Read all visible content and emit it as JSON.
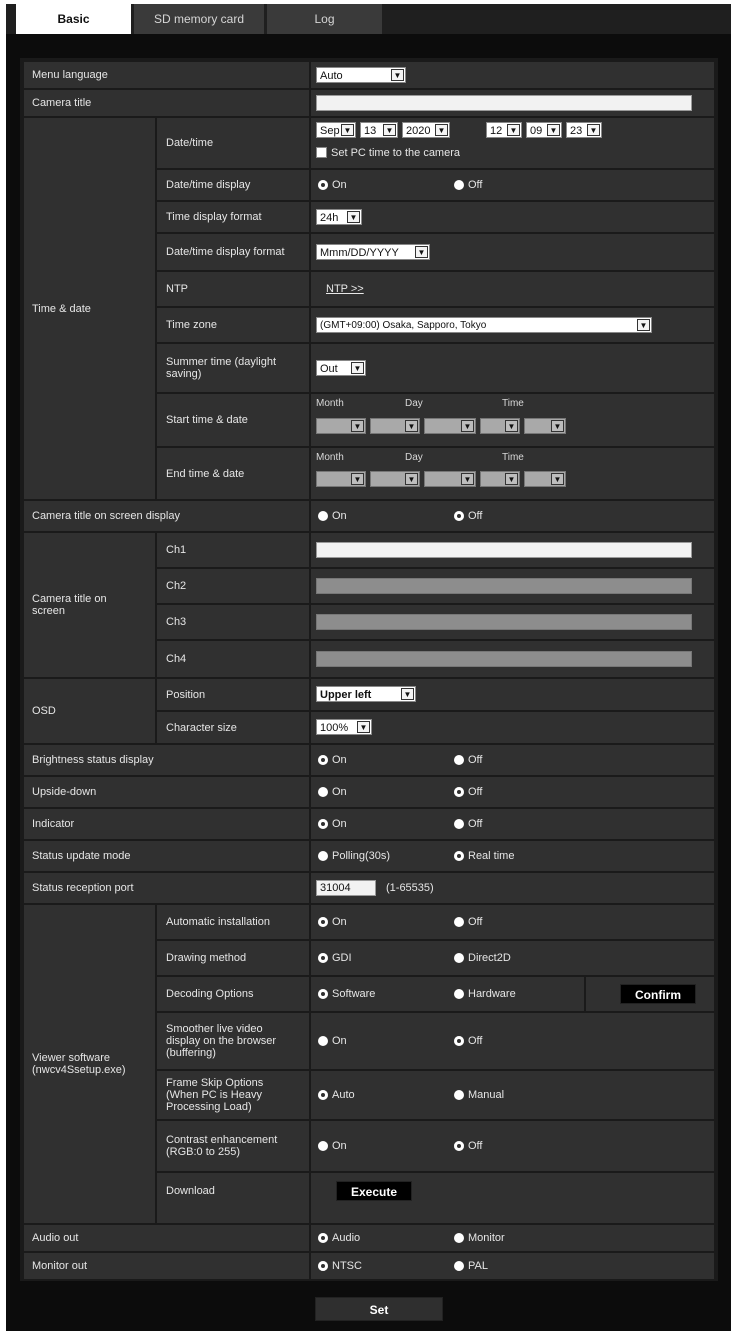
{
  "tabs": [
    {
      "label": "Basic",
      "active": true
    },
    {
      "label": "SD memory card",
      "active": false
    },
    {
      "label": "Log",
      "active": false
    }
  ],
  "menu_language": {
    "label": "Menu language",
    "value": "Auto"
  },
  "camera_title": {
    "label": "Camera title",
    "value": ""
  },
  "time_date": {
    "label": "Time & date",
    "datetime": {
      "label": "Date/time",
      "month": "Sep",
      "day": "13",
      "year": "2020",
      "hour": "12",
      "minute": "09",
      "second": "23",
      "set_pc_label": "Set PC time to the camera"
    },
    "datetime_display": {
      "label": "Date/time display",
      "on": "On",
      "off": "Off",
      "selected": "On"
    },
    "time_format": {
      "label": "Time display format",
      "value": "24h"
    },
    "date_format": {
      "label": "Date/time display format",
      "value": "Mmm/DD/YYYY"
    },
    "ntp": {
      "label": "NTP",
      "link": "NTP >>"
    },
    "time_zone": {
      "label": "Time zone",
      "value": "(GMT+09:00) Osaka, Sapporo, Tokyo"
    },
    "summer_time": {
      "label": "Summer time (daylight saving)",
      "value": "Out"
    },
    "start": {
      "label": "Start time & date",
      "month": "Month",
      "day": "Day",
      "time": "Time"
    },
    "end": {
      "label": "End time & date",
      "month": "Month",
      "day": "Day",
      "time": "Time"
    }
  },
  "camera_title_osd": {
    "label": "Camera title on screen display",
    "on": "On",
    "off": "Off",
    "selected": "Off"
  },
  "camera_title_screen": {
    "label": "Camera title on screen",
    "channels": [
      "Ch1",
      "Ch2",
      "Ch3",
      "Ch4"
    ]
  },
  "osd": {
    "label": "OSD",
    "position": {
      "label": "Position",
      "value": "Upper left"
    },
    "char_size": {
      "label": "Character size",
      "value": "100%"
    }
  },
  "brightness": {
    "label": "Brightness status display",
    "on": "On",
    "off": "Off",
    "selected": "On"
  },
  "upside_down": {
    "label": "Upside-down",
    "on": "On",
    "off": "Off",
    "selected": "Off"
  },
  "indicator": {
    "label": "Indicator",
    "on": "On",
    "off": "Off",
    "selected": "On"
  },
  "status_update": {
    "label": "Status update mode",
    "a": "Polling(30s)",
    "b": "Real time",
    "selected": "b"
  },
  "status_port": {
    "label": "Status reception port",
    "value": "31004",
    "range": "(1-65535)"
  },
  "viewer": {
    "label": "Viewer software (nwcv4Ssetup.exe)",
    "auto_install": {
      "label": "Automatic installation",
      "on": "On",
      "off": "Off",
      "selected": "On"
    },
    "drawing": {
      "label": "Drawing method",
      "a": "GDI",
      "b": "Direct2D",
      "selected": "a"
    },
    "decoding": {
      "label": "Decoding Options",
      "a": "Software",
      "b": "Hardware",
      "selected": "a",
      "confirm": "Confirm"
    },
    "smoother": {
      "label": "Smoother live video display on the browser (buffering)",
      "on": "On",
      "off": "Off",
      "selected": "Off"
    },
    "frame_skip": {
      "label": "Frame Skip Options (When PC is Heavy Processing Load)",
      "a": "Auto",
      "b": "Manual",
      "selected": "a"
    },
    "contrast": {
      "label": "Contrast enhancement (RGB:0 to 255)",
      "on": "On",
      "off": "Off",
      "selected": "Off"
    },
    "download": {
      "label": "Download",
      "button": "Execute"
    }
  },
  "audio_out": {
    "label": "Audio out",
    "a": "Audio",
    "b": "Monitor",
    "selected": "a"
  },
  "monitor_out": {
    "label": "Monitor out",
    "a": "NTSC",
    "b": "PAL",
    "selected": "a"
  },
  "set_button": "Set"
}
